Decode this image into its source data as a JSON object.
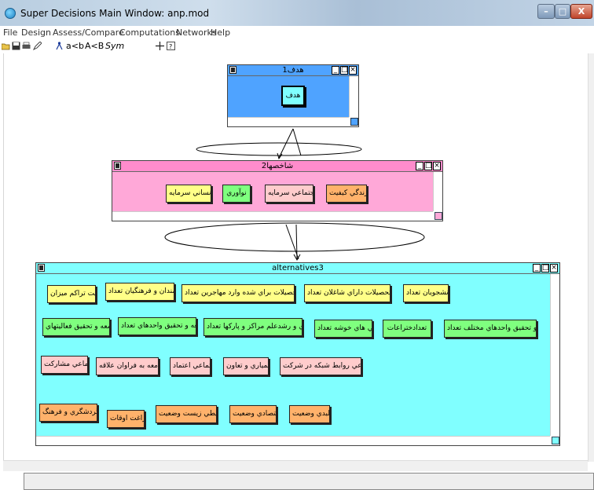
{
  "window": {
    "title": "Super Decisions Main Window: anp.mod"
  },
  "menu": [
    "File",
    "Design",
    "Assess/Compare",
    "Computations",
    "Networks",
    "Help"
  ],
  "toolbar": {
    "abc": "a<b",
    "ABC": "A<B",
    "sym": "Sym"
  },
  "clusters": {
    "goal": {
      "title": "هدف1",
      "nodes": [
        "هدف"
      ]
    },
    "criteria": {
      "title": "شاخصها2",
      "nodes": [
        "زندگي كيفيت",
        "اجتماعي سرمايه",
        "نوآوري",
        "انساني سرمايه"
      ]
    },
    "alternatives": {
      "title": "alternatives3",
      "row1": [
        "دانشجويان تعداد",
        "عالي تحصيلات داراي شاغلان تعداد",
        "عالي تحصيلات براي شده وارد مهاجرين تعداد",
        "هنرمندان و فرهنگيان تعداد",
        "جمعيت تراكم ميزان"
      ],
      "row2": [
        "توسعه و تحقيق واحدهاي مختلف تعداد",
        "تعدادختراعات",
        "صنعتي هاي خوشه تعداد",
        "فناوري و رشدعلم مراكز و پاركها تعداد",
        "توسعه و تحقيق واحدهاي تعداد",
        "توسعه و تحقيق فعاليتهاي"
      ],
      "row3": [
        "اجتماعي روابط شبكه در شركت",
        "همياري و تعاون",
        "اجتماعي اعتماد",
        "جامعه به فراوان علاقه",
        "اجتماعي مشاركت"
      ],
      "row4": [
        "كالبدي وضعيت",
        "اقتصادي وضعيت",
        "محيطي زيست وضعيت",
        "فراغت اوقات",
        "گردشگري و فرهنگ"
      ]
    }
  },
  "colors": {
    "goal_bg": "#4fa3ff",
    "criteria_bg": "#ffa8d8",
    "criteria_title": "#ff8ccc",
    "alt_bg": "#80ffff"
  }
}
